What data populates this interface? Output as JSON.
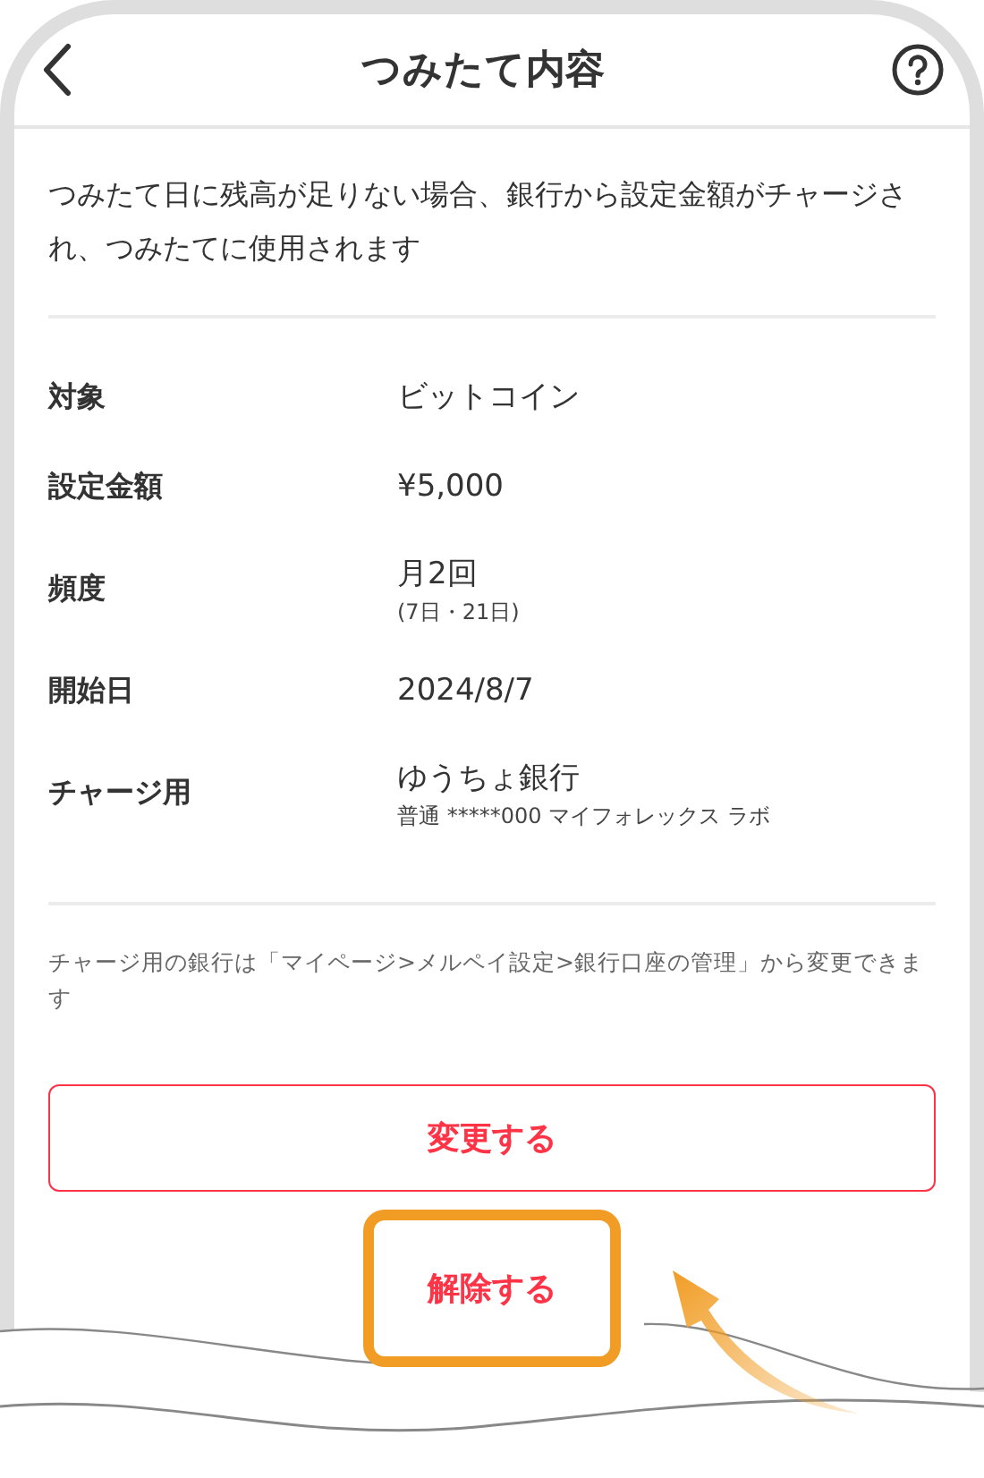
{
  "header": {
    "title": "つみたて内容"
  },
  "description": "つみたて日に残高が足りない場合、銀行から設定金額がチャージされ、つみたてに使用されます",
  "details": [
    {
      "label": "対象",
      "value": "ビットコイン"
    },
    {
      "label": "設定金額",
      "value": "¥5,000"
    },
    {
      "label": "頻度",
      "value": "月2回",
      "sub": "(7日・21日)"
    },
    {
      "label": "開始日",
      "value": "2024/8/7"
    },
    {
      "label": "チャージ用",
      "value": "ゆうちょ銀行",
      "sub": "普通 *****000 マイフォレックス ラボ"
    }
  ],
  "note": "チャージ用の銀行は「マイページ>メルペイ設定>銀行口座の管理」から変更できます",
  "buttons": [
    {
      "label": "変更する",
      "kind": "outlined",
      "highlighted": false
    },
    {
      "label": "解除する",
      "kind": "text",
      "highlighted": true
    }
  ]
}
